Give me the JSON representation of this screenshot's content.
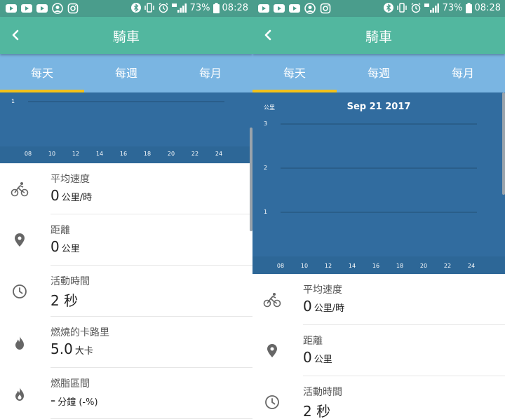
{
  "status": {
    "battery": "73%",
    "time": "08:28"
  },
  "header": {
    "title": "騎車"
  },
  "tabs": [
    "每天",
    "每週",
    "每月"
  ],
  "screens": [
    {
      "chart_data": {
        "type": "bar",
        "title": "",
        "ylabel": "",
        "y_ticks": [
          "1"
        ],
        "categories": [
          "08",
          "10",
          "12",
          "14",
          "16",
          "18",
          "20",
          "22",
          "24"
        ],
        "values": []
      },
      "stats": [
        {
          "icon": "bike-icon",
          "label": "平均速度",
          "value": "0",
          "unit": "公里/時"
        },
        {
          "icon": "location-pin-icon",
          "label": "距離",
          "value": "0",
          "unit": "公里"
        },
        {
          "icon": "clock-icon",
          "label": "活動時間",
          "value": "2 秒",
          "unit": ""
        },
        {
          "icon": "flame-icon",
          "label": "燃燒的卡路里",
          "value": "5.0",
          "unit": "大卡"
        },
        {
          "icon": "fat-burn-icon",
          "label": "燃脂區間",
          "value": "-",
          "unit": "分鐘 (-%)"
        }
      ]
    },
    {
      "chart_data": {
        "type": "bar",
        "title": "Sep 21 2017",
        "ylabel": "公里",
        "y_ticks": [
          "1",
          "2",
          "3"
        ],
        "categories": [
          "08",
          "10",
          "12",
          "14",
          "16",
          "18",
          "20",
          "22",
          "24"
        ],
        "values": []
      },
      "stats": [
        {
          "icon": "bike-icon",
          "label": "平均速度",
          "value": "0",
          "unit": "公里/時"
        },
        {
          "icon": "location-pin-icon",
          "label": "距離",
          "value": "0",
          "unit": "公里"
        },
        {
          "icon": "clock-icon",
          "label": "活動時間",
          "value": "2 秒",
          "unit": ""
        }
      ]
    }
  ]
}
